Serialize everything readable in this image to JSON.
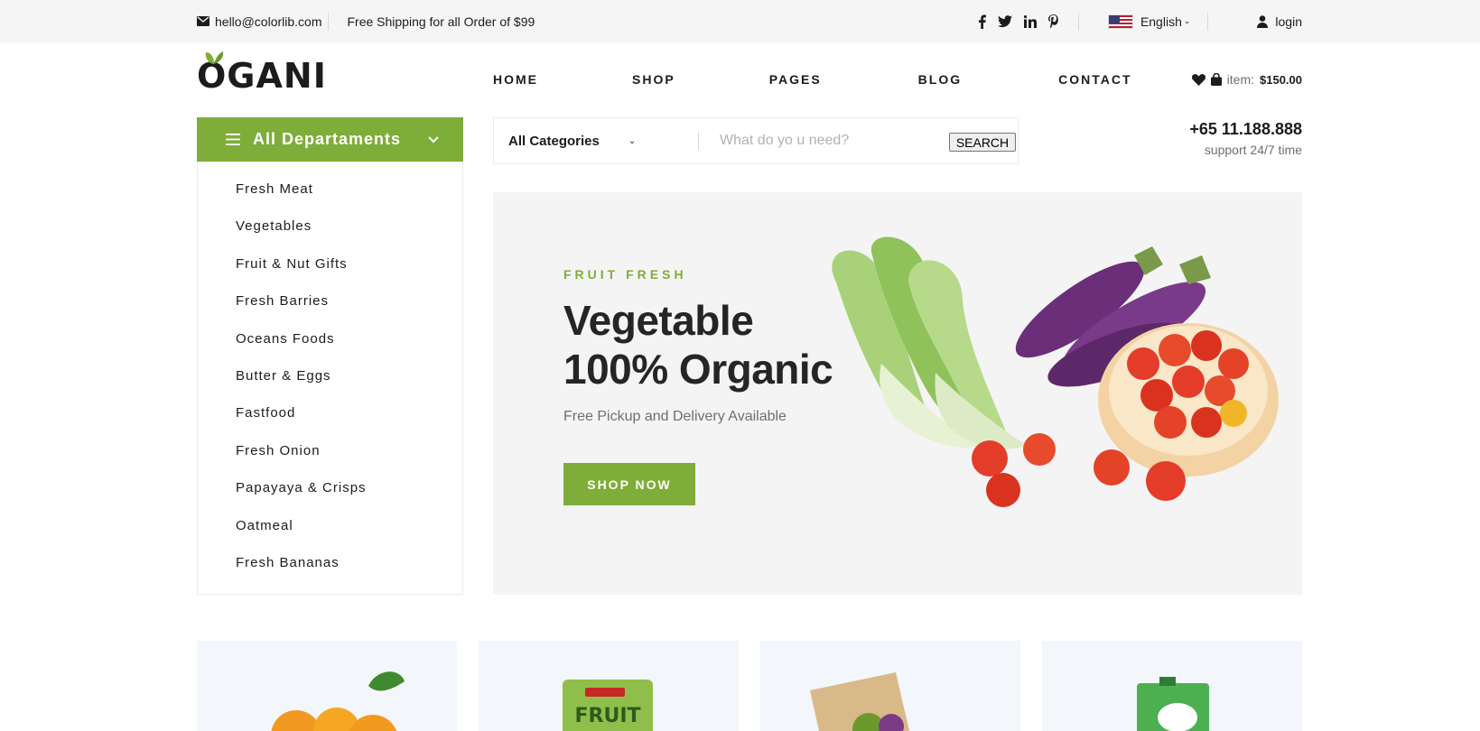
{
  "topbar": {
    "email": "hello@colorlib.com",
    "shipping": "Free Shipping for all Order of $99",
    "language": "English",
    "login": "login",
    "social_icons": [
      "facebook-icon",
      "twitter-icon",
      "linkedin-icon",
      "pinterest-icon"
    ]
  },
  "header": {
    "logo": "OGANI",
    "nav": [
      "HOME",
      "SHOP",
      "PAGES",
      "BLOG",
      "CONTACT"
    ],
    "cart_label": "item:",
    "cart_total": "$150.00"
  },
  "departments": {
    "title": "All Departaments",
    "items": [
      "Fresh Meat",
      "Vegetables",
      "Fruit & Nut Gifts",
      "Fresh Barries",
      "Oceans Foods",
      "Butter & Eggs",
      "Fastfood",
      "Fresh Onion",
      "Papayaya & Crisps",
      "Oatmeal",
      "Fresh Bananas"
    ]
  },
  "search": {
    "category": "All Categories",
    "placeholder": "What do yo u need?",
    "button": "SEARCH"
  },
  "contact": {
    "phone": "+65 11.188.888",
    "support": "support 24/7 time"
  },
  "hero": {
    "kicker": "FRUIT FRESH",
    "title_line1": "Vegetable",
    "title_line2": "100% Organic",
    "subtitle": "Free Pickup and Delivery Available",
    "button": "SHOP NOW"
  },
  "colors": {
    "accent": "#7fad39",
    "topbar_bg": "#f5f5f5",
    "hero_bg": "#f4f4f4"
  }
}
